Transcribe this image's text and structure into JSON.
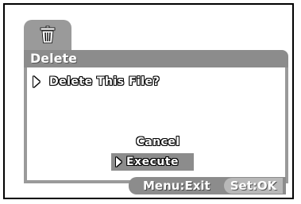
{
  "dialog": {
    "title": "Delete",
    "question": "Delete This File?",
    "options": {
      "cancel": "Cancel",
      "execute": "Execute",
      "selected": "Execute"
    }
  },
  "footer": {
    "menu_hint": "Menu:Exit",
    "set_hint": "Set:OK"
  },
  "icons": {
    "tab_icon": "trash-icon"
  },
  "colors": {
    "panel_gray": "#8c8c8c",
    "tab_gray": "#9a9a9a",
    "highlight_gray": "#8c8c8c",
    "text_white": "#ffffff"
  }
}
